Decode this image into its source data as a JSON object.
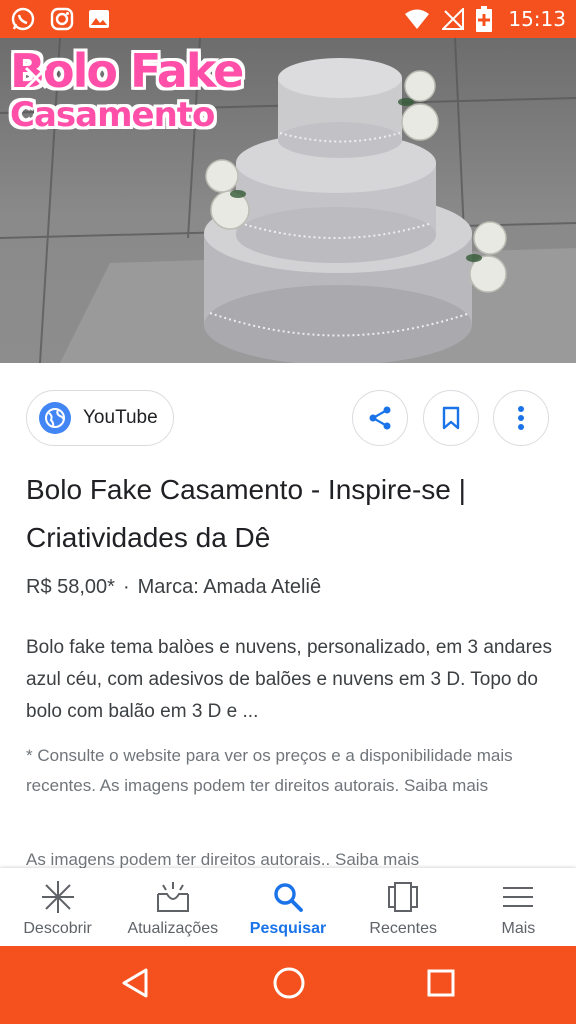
{
  "status_bar": {
    "time": "15:13",
    "icons_left": [
      "whatsapp-icon",
      "instagram-icon",
      "gallery-icon"
    ],
    "icons_right": [
      "wifi-icon",
      "no-signal-icon",
      "battery-charging-icon"
    ],
    "background": "#f4511e"
  },
  "hero": {
    "overlay_title_line1": "Bolo Fake",
    "overlay_title_line2": "Casamento",
    "overlay_color": "#ff4fa8"
  },
  "actions": {
    "source_label": "YouTube",
    "share_icon": "share-icon",
    "bookmark_icon": "bookmark-icon",
    "more_icon": "more-vert-icon"
  },
  "result": {
    "title": "Bolo Fake Casamento - Inspire-se | Criatividades da Dê",
    "price": "R$ 58,00*",
    "separator": "·",
    "brand": "Marca: Amada Ateliê",
    "description": "Bolo fake tema balòes e nuvens, personalizado, em 3 andares azul céu, com adesivos de balões e nuvens em 3 D. Topo do bolo com balão em 3 D e ...",
    "disclaimer": "* Consulte o website para ver os preços e a disponibilidade mais recentes. As imagens podem ter direitos autorais. Saiba mais",
    "disclaimer2": "As imagens podem ter direitos autorais.. Saiba mais"
  },
  "bottom_nav": {
    "items": [
      {
        "label": "Descobrir",
        "icon": "asterisk-icon",
        "active": false
      },
      {
        "label": "Atualizações",
        "icon": "inbox-updates-icon",
        "active": false
      },
      {
        "label": "Pesquisar",
        "icon": "search-icon",
        "active": true
      },
      {
        "label": "Recentes",
        "icon": "recents-icon",
        "active": false
      },
      {
        "label": "Mais",
        "icon": "menu-icon",
        "active": false
      }
    ],
    "active_color": "#1a73e8"
  },
  "system_nav": {
    "buttons": [
      "back-icon",
      "home-icon",
      "overview-icon"
    ]
  }
}
